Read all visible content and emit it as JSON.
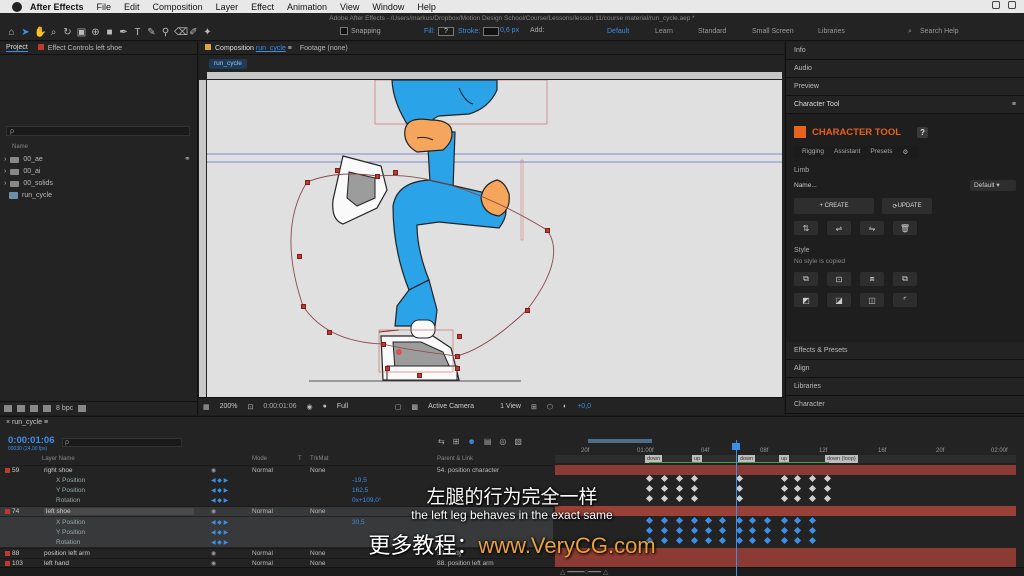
{
  "menubar": {
    "app": "After Effects",
    "items": [
      "File",
      "Edit",
      "Composition",
      "Layer",
      "Effect",
      "Animation",
      "View",
      "Window",
      "Help"
    ]
  },
  "toolbar": {
    "title": "Adobe After Effects - /Users/markus/Dropbox/Motion Design School/Course/Lessons/lesson 11/course material/run_cycle.aep *",
    "snapping": "Snapping",
    "fill_label": "Fill:",
    "fill_value": "?",
    "stroke_label": "Stroke:",
    "stroke_width": "0,6 px",
    "add_label": "Add:",
    "workspaces": [
      "Default",
      "Learn",
      "Standard",
      "Small Screen",
      "Libraries"
    ],
    "search_help": "Search Help"
  },
  "project": {
    "tab_project": "Project",
    "tab_effect": "Effect Controls left shoe",
    "search_placeholder": "ρ",
    "name_header": "Name",
    "items": [
      "00_ae",
      "00_ai",
      "00_solids",
      "run_cycle"
    ],
    "bpc": "8 bpc"
  },
  "viewer": {
    "tab_comp_prefix": "Composition",
    "tab_comp": "run_cycle",
    "tab_footage": "Footage (none)",
    "breadcrumb": "run_cycle",
    "zoom": "200%",
    "timecode": "0:00:01:06",
    "resolution": "Full",
    "camera": "Active Camera",
    "views": "1 View",
    "exposure": "+0,0"
  },
  "right": {
    "info": "Info",
    "audio": "Audio",
    "preview": "Preview",
    "character_tool": "Character Tool",
    "ct_title": "CHARACTER TOOL",
    "ct_help": "?",
    "tabs": [
      "Rigging",
      "Assistant",
      "Presets"
    ],
    "limb": "Limb",
    "name_label": "Name...",
    "default_dd": "Default",
    "create": "+ CREATE",
    "update": "UPDATE",
    "style": "Style",
    "no_style": "No style is copied",
    "effects_presets": "Effects & Presets",
    "align": "Align",
    "libraries": "Libraries",
    "character": "Character"
  },
  "timeline": {
    "tab": "run_cycle",
    "timecode": "0:00:01:06",
    "fps": "00030 (24,00 fps)",
    "search_placeholder": "ρ",
    "headers": {
      "layer_name": "Layer Name",
      "mode": "Mode",
      "t": "T",
      "trkmat": "TrkMat",
      "parent": "Parent & Link"
    },
    "ruler_labels": [
      "20f",
      "01:00f",
      "04f",
      "08f",
      "12f",
      "16f",
      "20f",
      "02:00f"
    ],
    "markers": [
      "down",
      "up",
      "down",
      "up",
      "down (loop)"
    ],
    "rows": [
      {
        "num": "59",
        "name": "right shoe",
        "mode": "Normal",
        "trk": "None",
        "parent": "54. position character",
        "value": ""
      },
      {
        "num": "",
        "name": "X Position",
        "mode": "",
        "trk": "",
        "parent": "",
        "value": "-19,5"
      },
      {
        "num": "",
        "name": "Y Position",
        "mode": "",
        "trk": "",
        "parent": "",
        "value": "162,5"
      },
      {
        "num": "",
        "name": "Rotation",
        "mode": "",
        "trk": "",
        "parent": "",
        "value": "0x+109,0°"
      },
      {
        "num": "74",
        "name": "left shoe",
        "mode": "Normal",
        "trk": "None",
        "parent": "",
        "value": ""
      },
      {
        "num": "",
        "name": "X Position",
        "mode": "",
        "trk": "",
        "parent": "",
        "value": "30,5"
      },
      {
        "num": "",
        "name": "Y Position",
        "mode": "",
        "trk": "",
        "parent": "",
        "value": ""
      },
      {
        "num": "",
        "name": "Rotation",
        "mode": "",
        "trk": "",
        "parent": "",
        "value": ""
      },
      {
        "num": "88",
        "name": "position left arm",
        "mode": "Normal",
        "trk": "None",
        "parent": "50. body",
        "value": ""
      },
      {
        "num": "103",
        "name": "left hand",
        "mode": "Normal",
        "trk": "None",
        "parent": "88. position left arm",
        "value": ""
      }
    ]
  },
  "subtitles": {
    "zh": "左腿的行为完全一样",
    "en": "the left leg behaves in the exact same",
    "promo_prefix": "更多教程：",
    "promo_url": "www.VeryCG.com"
  },
  "colors": {
    "accent": "#3d8ee6",
    "label_red": "#c0392b",
    "ct_orange": "#e8611d",
    "character_blue": "#2aa3e8",
    "hand_orange": "#f5a65c"
  }
}
